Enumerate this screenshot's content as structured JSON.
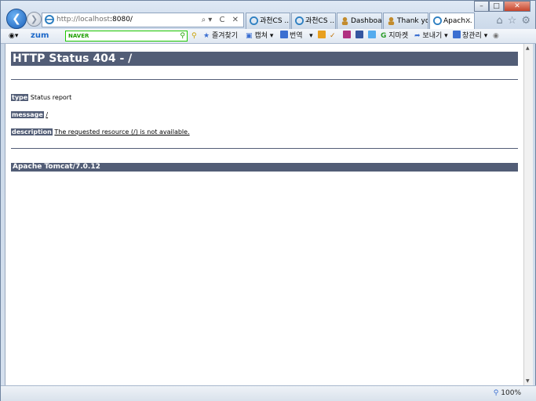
{
  "browser": {
    "address_url_host": "http://localhost",
    "address_url_port": ":8080/",
    "address_tools": "⌕▾ C ✕",
    "tabs": [
      {
        "label": "과천CS ...",
        "icon_color": "#2d7fc1",
        "active": false
      },
      {
        "label": "과천CS ...",
        "icon_color": "#2d7fc1",
        "active": false
      },
      {
        "label": "Dashboa...",
        "icon_color": "#c28b2c",
        "active": false
      },
      {
        "label": "Thank yo...",
        "icon_color": "#c28b2c",
        "active": false
      },
      {
        "label": "Apach...",
        "icon_color": "#2d7fc1",
        "active": true
      }
    ],
    "tab_close": "✕",
    "window_min": "–",
    "window_max": "□",
    "window_close": "✕",
    "zoom": "100%"
  },
  "commandbar": {
    "zum": "zum",
    "naver": "NAVER",
    "favorites": "즐겨찾기",
    "capture": "캡쳐",
    "translate": "번역",
    "jimaket": "지마켓",
    "send": "보내기",
    "window_mgmt": "창관리"
  },
  "page": {
    "title": "HTTP Status 404 - /",
    "type_label": "type",
    "type_value": "Status report",
    "message_label": "message",
    "message_value": "/",
    "description_label": "description",
    "description_value": "The requested resource (/) is not available.",
    "footer": "Apache Tomcat/7.0.12"
  },
  "colors": {
    "tomcat_bar": "#525d76",
    "ie_accent": "#1a5fb8",
    "naver_green": "#1ec800"
  }
}
